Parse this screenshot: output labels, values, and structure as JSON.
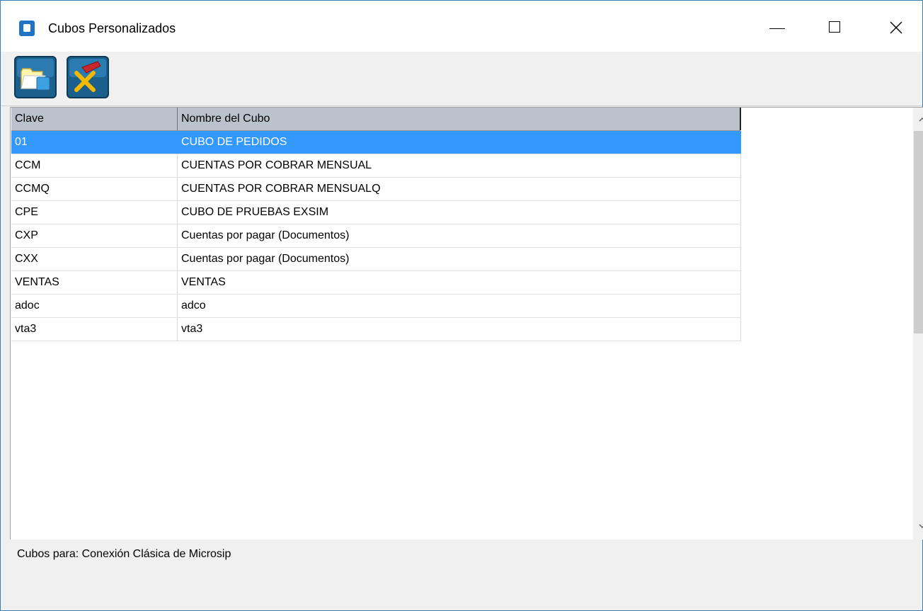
{
  "window": {
    "title": "Cubos Personalizados",
    "controls": [
      "minimize-icon",
      "maximize-icon",
      "close-icon"
    ]
  },
  "toolbar": {
    "buttons": [
      {
        "name": "open-cube",
        "icon": "open-folder-icon"
      },
      {
        "name": "delete-cube",
        "icon": "delete-x-icon"
      }
    ]
  },
  "grid": {
    "columns": [
      "Clave",
      "Nombre del Cubo"
    ],
    "rows": [
      {
        "clave": "01",
        "nombre": "CUBO DE PEDIDOS",
        "selected": true
      },
      {
        "clave": "CCM",
        "nombre": "CUENTAS POR COBRAR MENSUAL"
      },
      {
        "clave": "CCMQ",
        "nombre": "CUENTAS POR COBRAR MENSUALQ"
      },
      {
        "clave": "CPE",
        "nombre": "CUBO DE PRUEBAS EXSIM"
      },
      {
        "clave": "CXP",
        "nombre": "Cuentas por pagar (Documentos)"
      },
      {
        "clave": "CXX",
        "nombre": "Cuentas por pagar (Documentos)"
      },
      {
        "clave": "VENTAS",
        "nombre": "VENTAS"
      },
      {
        "clave": "adoc",
        "nombre": "adco"
      },
      {
        "clave": "vta3",
        "nombre": "vta3"
      }
    ]
  },
  "status": {
    "text": "Cubos para: Conexión Clásica de Microsip"
  },
  "colors": {
    "selection": "#3399ff",
    "header": "#b9c2cd",
    "toolbar_icon_bg": "#1b5f8c"
  }
}
